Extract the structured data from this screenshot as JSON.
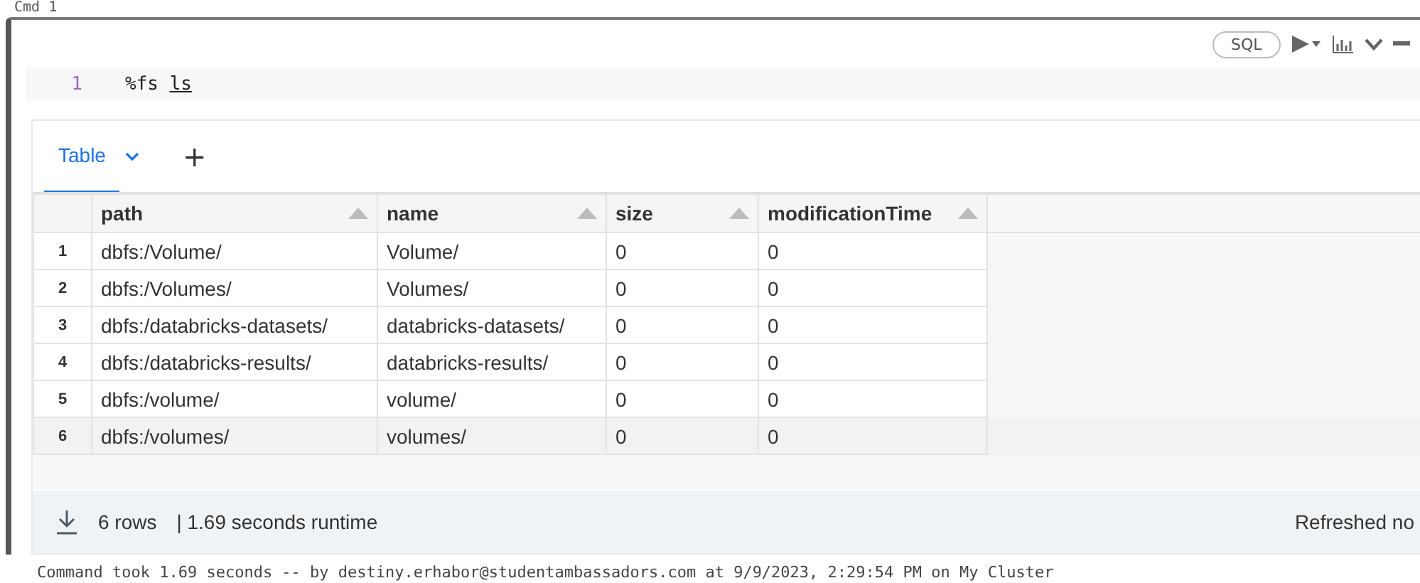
{
  "cell_label": "Cmd 1",
  "toolbar": {
    "language": "SQL"
  },
  "code": {
    "line_number": "1",
    "command": "%fs",
    "argument": "ls"
  },
  "tabs": [
    {
      "label": "Table",
      "selected": true
    }
  ],
  "add_tab": "+",
  "table": {
    "columns": [
      {
        "label": "path"
      },
      {
        "label": "name"
      },
      {
        "label": "size"
      },
      {
        "label": "modificationTime"
      }
    ],
    "rows": [
      {
        "index": "1",
        "cells": [
          "dbfs:/Volume/",
          "Volume/",
          "0",
          "0"
        ],
        "highlighted": false
      },
      {
        "index": "2",
        "cells": [
          "dbfs:/Volumes/",
          "Volumes/",
          "0",
          "0"
        ],
        "highlighted": false
      },
      {
        "index": "3",
        "cells": [
          "dbfs:/databricks-datasets/",
          "databricks-datasets/",
          "0",
          "0"
        ],
        "highlighted": false
      },
      {
        "index": "4",
        "cells": [
          "dbfs:/databricks-results/",
          "databricks-results/",
          "0",
          "0"
        ],
        "highlighted": false
      },
      {
        "index": "5",
        "cells": [
          "dbfs:/volume/",
          "volume/",
          "0",
          "0"
        ],
        "highlighted": false
      },
      {
        "index": "6",
        "cells": [
          "dbfs:/volumes/",
          "volumes/",
          "0",
          "0"
        ],
        "highlighted": true
      }
    ]
  },
  "footer": {
    "rows": "6 rows",
    "runtime": "| 1.69 seconds runtime",
    "refreshed": "Refreshed no"
  },
  "status": "Command took 1.69 seconds -- by destiny.erhabor@studentambassadors.com at 9/9/2023, 2:29:54 PM on My Cluster"
}
